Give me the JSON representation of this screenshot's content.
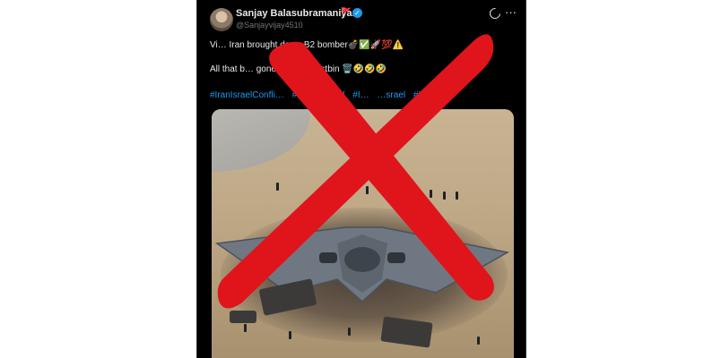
{
  "tweet": {
    "author_name": "Sanjay Balasubramaniyam",
    "flag_glyph": "🚩",
    "verified_glyph": "✓",
    "handle": "@Sanjayvijay4510",
    "more_glyph": "···",
    "line1_text": "Vi… Iran brought down B2 bomber💣✅🚀💯⚠️",
    "line2_text": "All that b… gone into the dustbin 🗑️🤣🤣🤣",
    "hashtags": [
      "#IranIsraelConfli…",
      "#IranVsIsrael",
      "#I…",
      "…srael",
      "#Irán"
    ]
  },
  "icons": {
    "avatar": "user-avatar",
    "verified": "verified-badge-icon",
    "grok": "grok-icon",
    "more": "more-options-icon",
    "overlay": "red-x-mark"
  },
  "colors": {
    "tweet_bg": "#000000",
    "text": "#e7e9ea",
    "muted": "#71767b",
    "link": "#1d9bf0",
    "cross": "#e0141b"
  }
}
